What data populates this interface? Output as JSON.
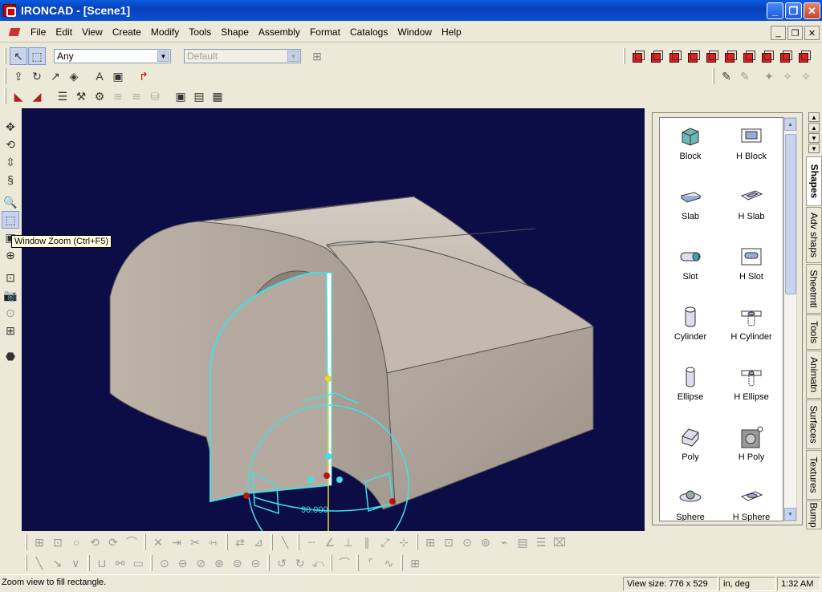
{
  "window": {
    "app": "IRONCAD",
    "title": "IRONCAD - [Scene1]"
  },
  "menu": [
    "File",
    "Edit",
    "View",
    "Create",
    "Modify",
    "Tools",
    "Shape",
    "Assembly",
    "Format",
    "Catalogs",
    "Window",
    "Help"
  ],
  "toolbar": {
    "selection_filter": "Any",
    "style_select": "Default"
  },
  "tooltip": "Window Zoom (Ctrl+F5)",
  "viewport": {
    "rotation_angle": "90.000",
    "background": "#0c0c46",
    "part_color": "#c2b8ac",
    "handle_color": "#40e0e8"
  },
  "catalog": {
    "items": [
      {
        "label": "Block",
        "icon": "block-icon"
      },
      {
        "label": "H Block",
        "icon": "h-block-icon"
      },
      {
        "label": "Slab",
        "icon": "slab-icon"
      },
      {
        "label": "H Slab",
        "icon": "h-slab-icon"
      },
      {
        "label": "Slot",
        "icon": "slot-icon"
      },
      {
        "label": "H Slot",
        "icon": "h-slot-icon"
      },
      {
        "label": "Cylinder",
        "icon": "cylinder-icon"
      },
      {
        "label": "H Cylinder",
        "icon": "h-cylinder-icon"
      },
      {
        "label": "Ellipse",
        "icon": "ellipse-icon"
      },
      {
        "label": "H Ellipse",
        "icon": "h-ellipse-icon"
      },
      {
        "label": "Poly",
        "icon": "poly-icon"
      },
      {
        "label": "H Poly",
        "icon": "h-poly-icon"
      },
      {
        "label": "Sphere",
        "icon": "sphere-icon"
      },
      {
        "label": "H Sphere",
        "icon": "h-sphere-icon"
      }
    ],
    "tabs": [
      "Shapes",
      "Adv shaps",
      "Sheetmtl",
      "Tools",
      "Animatn",
      "Surfaces",
      "Textures",
      "Bump"
    ],
    "active_tab": "Shapes"
  },
  "status": {
    "message": "Zoom view to fill rectangle.",
    "view_size": "View size:  776 x  529",
    "units": "in, deg",
    "time": "1:32 AM"
  }
}
